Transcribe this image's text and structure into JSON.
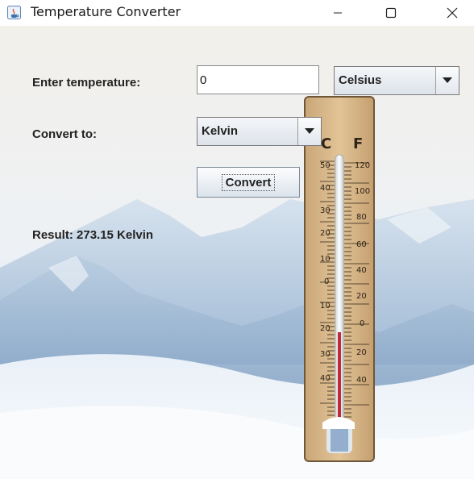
{
  "window": {
    "title": "Temperature Converter",
    "controls": [
      "minimize-icon",
      "maximize-icon",
      "close-icon"
    ]
  },
  "form": {
    "temperature_label": "Enter temperature:",
    "temperature_value": "0",
    "from_unit": "Celsius",
    "convert_to_label": "Convert to:",
    "to_unit": "Kelvin",
    "convert_button": "Convert",
    "result_text": "Result: 273.15 Kelvin"
  },
  "thermometer": {
    "celsius_symbol": "C",
    "fahrenheit_symbol": "F",
    "celsius_ticks": [
      "50",
      "40",
      "30",
      "20",
      "10",
      "0",
      "10",
      "20",
      "30",
      "40"
    ],
    "fahrenheit_ticks": [
      "120",
      "100",
      "80",
      "60",
      "40",
      "20",
      "0",
      "20",
      "40"
    ]
  },
  "colors": {
    "sky": "#e8eef4",
    "snow": "#f4f8fc",
    "mountain": "#9fb9d4",
    "thermometer_board": "#d9b98c",
    "mercury": "#c22a3a"
  }
}
